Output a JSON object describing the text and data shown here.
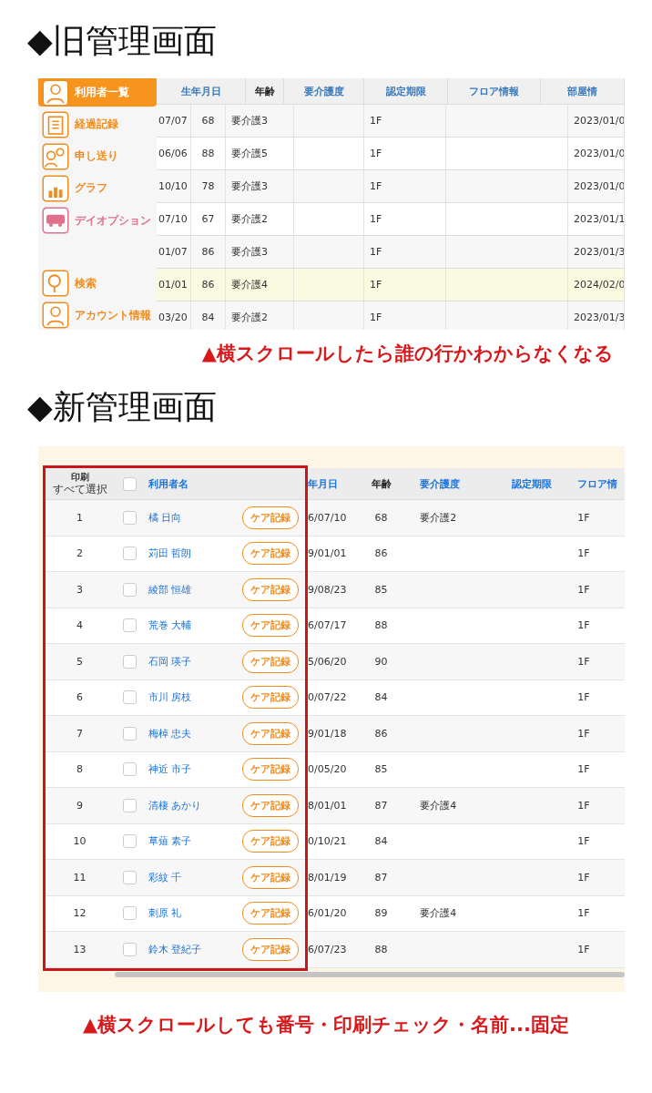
{
  "old_section": {
    "heading": "◆旧管理画面",
    "sidebar": {
      "items": [
        {
          "label": "利用者一覧",
          "kind": "person",
          "selected": true,
          "color": "#f08c1e"
        },
        {
          "label": "経過記録",
          "kind": "clipboard",
          "selected": false,
          "color": "#f08c1e"
        },
        {
          "label": "申し送り",
          "kind": "people",
          "selected": false,
          "color": "#f08c1e"
        },
        {
          "label": "グラフ",
          "kind": "chart",
          "selected": false,
          "color": "#f08c1e"
        },
        {
          "label": "デイオプション",
          "kind": "van",
          "selected": false,
          "color": "#e0708c"
        },
        {
          "label": "検索",
          "kind": "search",
          "selected": false,
          "color": "#f08c1e",
          "gap_before": true
        },
        {
          "label": "アカウント情報",
          "kind": "person",
          "selected": false,
          "color": "#f08c1e"
        }
      ]
    },
    "table": {
      "columns": [
        {
          "label": "生年月日",
          "sortable": true
        },
        {
          "label": "年齢",
          "sortable": false
        },
        {
          "label": "要介護度",
          "sortable": true
        },
        {
          "label": "認定期限",
          "sortable": true
        },
        {
          "label": "フロア情報",
          "sortable": true
        },
        {
          "label": "部屋情",
          "sortable": true
        }
      ],
      "rows": [
        {
          "selected": false,
          "cells": [
            "07/07",
            "68",
            "要介護3",
            "",
            "1F",
            "",
            "2023/01/0"
          ]
        },
        {
          "selected": false,
          "cells": [
            "06/06",
            "88",
            "要介護5",
            "",
            "1F",
            "",
            "2023/01/0"
          ]
        },
        {
          "selected": false,
          "cells": [
            "10/10",
            "78",
            "要介護3",
            "",
            "1F",
            "",
            "2023/01/0"
          ]
        },
        {
          "selected": false,
          "cells": [
            "07/10",
            "67",
            "要介護2",
            "",
            "1F",
            "",
            "2023/01/1"
          ]
        },
        {
          "selected": false,
          "cells": [
            "01/07",
            "86",
            "要介護3",
            "",
            "1F",
            "",
            "2023/01/3"
          ]
        },
        {
          "selected": true,
          "cells": [
            "01/01",
            "86",
            "要介護4",
            "",
            "1F",
            "",
            "2024/02/0"
          ]
        },
        {
          "selected": false,
          "cells": [
            "03/20",
            "84",
            "要介護2",
            "",
            "1F",
            "",
            "2023/01/3"
          ]
        }
      ]
    },
    "caption": "▲横スクロールしたら誰の行かわからなくなる"
  },
  "new_section": {
    "heading": "◆新管理画面",
    "table": {
      "print_header": {
        "label": "印刷",
        "sublabel": "すべて選択",
        "checked": false
      },
      "name_column": "利用者名",
      "columns": [
        {
          "label": "年月日",
          "sortable": true
        },
        {
          "label": "年齢",
          "sortable": false
        },
        {
          "label": "要介護度",
          "sortable": true
        },
        {
          "label": "認定期限",
          "sortable": true
        },
        {
          "label": "フロア情",
          "sortable": true
        }
      ],
      "rows": [
        {
          "no": "1",
          "checked": false,
          "name": "橘 日向",
          "button": "ケア記録",
          "cells": [
            "6/07/10",
            "68",
            "要介護2",
            "",
            "1F"
          ]
        },
        {
          "no": "2",
          "checked": false,
          "name": "苅田 哲朗",
          "button": "ケア記録",
          "cells": [
            "9/01/01",
            "86",
            "",
            "",
            "1F"
          ]
        },
        {
          "no": "3",
          "checked": false,
          "name": "綾部 恒雄",
          "button": "ケア記録",
          "cells": [
            "9/08/23",
            "85",
            "",
            "",
            "1F"
          ]
        },
        {
          "no": "4",
          "checked": false,
          "name": "荒巻 大輔",
          "button": "ケア記録",
          "cells": [
            "6/07/17",
            "88",
            "",
            "",
            "1F"
          ]
        },
        {
          "no": "5",
          "checked": false,
          "name": "石岡 瑛子",
          "button": "ケア記録",
          "cells": [
            "5/06/20",
            "90",
            "",
            "",
            "1F"
          ]
        },
        {
          "no": "6",
          "checked": false,
          "name": "市川 房枝",
          "button": "ケア記録",
          "cells": [
            "0/07/22",
            "84",
            "",
            "",
            "1F"
          ]
        },
        {
          "no": "7",
          "checked": false,
          "name": "梅棹 忠夫",
          "button": "ケア記録",
          "cells": [
            "9/01/18",
            "86",
            "",
            "",
            "1F"
          ]
        },
        {
          "no": "8",
          "checked": false,
          "name": "神近 市子",
          "button": "ケア記録",
          "cells": [
            "0/05/20",
            "85",
            "",
            "",
            "1F"
          ]
        },
        {
          "no": "9",
          "checked": false,
          "name": "清棲 あかり",
          "button": "ケア記録",
          "cells": [
            "8/01/01",
            "87",
            "要介護4",
            "",
            "1F"
          ]
        },
        {
          "no": "10",
          "checked": false,
          "name": "草薙 素子",
          "button": "ケア記録",
          "cells": [
            "0/10/21",
            "84",
            "",
            "",
            "1F"
          ]
        },
        {
          "no": "11",
          "checked": false,
          "name": "彩紋 千",
          "button": "ケア記録",
          "cells": [
            "8/01/19",
            "87",
            "",
            "",
            "1F"
          ]
        },
        {
          "no": "12",
          "checked": false,
          "name": "刺原 礼",
          "button": "ケア記録",
          "cells": [
            "6/01/20",
            "89",
            "要介護4",
            "",
            "1F"
          ]
        },
        {
          "no": "13",
          "checked": false,
          "name": "鈴木 登紀子",
          "button": "ケア記録",
          "cells": [
            "6/07/23",
            "88",
            "",
            "",
            "1F"
          ]
        }
      ]
    },
    "caption": "▲横スクロールしても番号・印刷チェック・名前...固定"
  }
}
